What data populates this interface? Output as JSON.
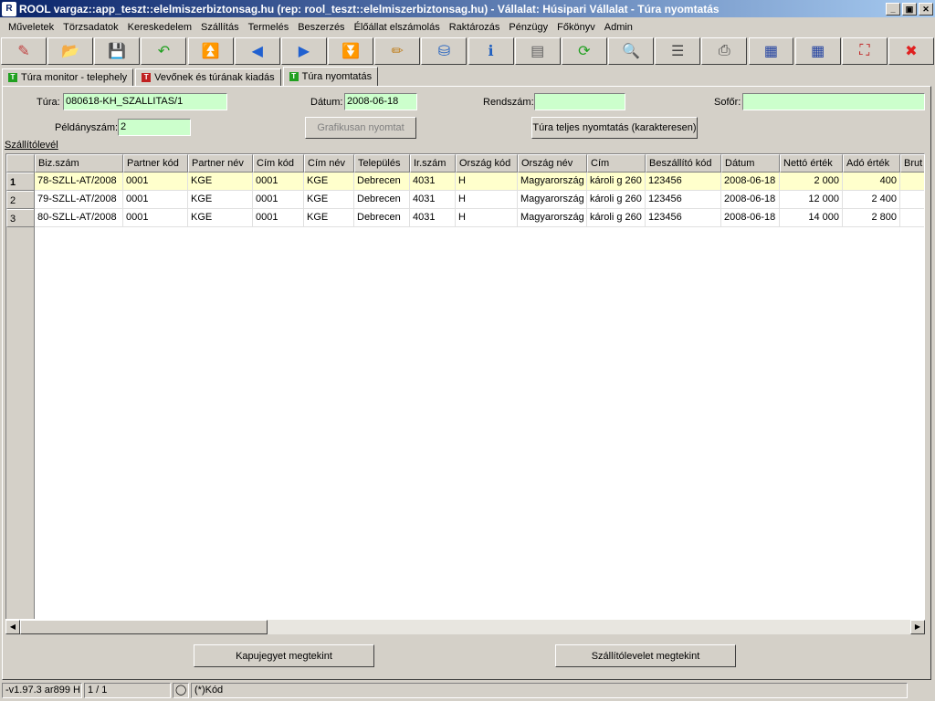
{
  "window": {
    "title": "ROOL vargaz::app_teszt::elelmiszerbiztonsag.hu (rep: rool_teszt::elelmiszerbiztonsag.hu) - Vállalat: Húsipari Vállalat - Túra nyomtatás",
    "minimize": "_",
    "maximize": "▣",
    "close": "✕"
  },
  "menu": [
    "Műveletek",
    "Törzsadatok",
    "Kereskedelem",
    "Szállítás",
    "Termelés",
    "Beszerzés",
    "Élőállat elszámolás",
    "Raktározás",
    "Pénzügy",
    "Főkönyv",
    "Admin"
  ],
  "toolbar": [
    {
      "icon": "edit-bolt-icon",
      "glyph": "✎",
      "color": "#c04040"
    },
    {
      "icon": "open-folder-icon",
      "glyph": "📂",
      "color": "#2060c0"
    },
    {
      "icon": "save-icon",
      "glyph": "💾",
      "color": "#2040a0"
    },
    {
      "icon": "undo-icon",
      "glyph": "↶",
      "color": "#20a020"
    },
    {
      "icon": "first-record-icon",
      "glyph": "⏫",
      "color": "#2060d0"
    },
    {
      "icon": "previous-record-icon",
      "glyph": "◀",
      "color": "#2060d0"
    },
    {
      "icon": "next-record-icon",
      "glyph": "▶",
      "color": "#2060d0"
    },
    {
      "icon": "last-record-icon",
      "glyph": "⏬",
      "color": "#2060d0"
    },
    {
      "icon": "notepad-icon",
      "glyph": "✏",
      "color": "#c08020"
    },
    {
      "icon": "database-icon",
      "glyph": "⛁",
      "color": "#2060c0"
    },
    {
      "icon": "info-icon",
      "glyph": "ℹ",
      "color": "#2060c0"
    },
    {
      "icon": "form-view-icon",
      "glyph": "▤",
      "color": "#606060"
    },
    {
      "icon": "refresh-icon",
      "glyph": "⟳",
      "color": "#20a020"
    },
    {
      "icon": "search-icon",
      "glyph": "🔍",
      "color": "#404040"
    },
    {
      "icon": "columns-icon",
      "glyph": "☰",
      "color": "#404040"
    },
    {
      "icon": "print-icon",
      "glyph": "⎙",
      "color": "#404040"
    },
    {
      "icon": "grid-export-icon",
      "glyph": "▦",
      "color": "#2040a0"
    },
    {
      "icon": "grid-import-icon",
      "glyph": "▦",
      "color": "#2040a0"
    },
    {
      "icon": "fullscreen-icon",
      "glyph": "⛶",
      "color": "#c02020"
    },
    {
      "icon": "exit-icon",
      "glyph": "✖",
      "color": "#e02020"
    }
  ],
  "tabs": [
    {
      "label": "Túra monitor - telephely",
      "icon_color": "#20a020",
      "icon_letter": "T"
    },
    {
      "label": "Vevőnek és túrának kiadás",
      "icon_color": "#c02020",
      "icon_letter": "T"
    },
    {
      "label": "Túra nyomtatás",
      "icon_color": "#20a020",
      "icon_letter": "T"
    }
  ],
  "form": {
    "tura_label": "Túra:",
    "tura_value": "080618-KH_SZALLITAS/1",
    "datum_label": "Dátum:",
    "datum_value": "2008-06-18",
    "rendszam_label": "Rendszám:",
    "rendszam_value": "",
    "sofor_label": "Sofőr:",
    "sofor_value": "",
    "peldanyszam_label": "Példányszám:",
    "peldanyszam_value": "2",
    "grafikus_button": "Grafikusan nyomtat",
    "teljes_button": "Túra teljes nyomtatás (karakteresen)",
    "grid_caption": "Szállítólevél"
  },
  "grid": {
    "columns": [
      "Biz.szám",
      "Partner kód",
      "Partner név",
      "Cím kód",
      "Cím név",
      "Település",
      "Ir.szám",
      "Ország kód",
      "Ország név",
      "Cím",
      "Beszállító kód",
      "Dátum",
      "Nettó érték",
      "Adó érték",
      "Brut"
    ],
    "rows": [
      {
        "num": "1",
        "cells": [
          "78-SZLL-AT/2008",
          "0001",
          "KGE",
          "0001",
          "KGE",
          "Debrecen",
          "4031",
          "H",
          "Magyarország",
          "károli g 260",
          "123456",
          "2008-06-18",
          "2 000",
          "400",
          ""
        ]
      },
      {
        "num": "2",
        "cells": [
          "79-SZLL-AT/2008",
          "0001",
          "KGE",
          "0001",
          "KGE",
          "Debrecen",
          "4031",
          "H",
          "Magyarország",
          "károli g 260",
          "123456",
          "2008-06-18",
          "12 000",
          "2 400",
          ""
        ]
      },
      {
        "num": "3",
        "cells": [
          "80-SZLL-AT/2008",
          "0001",
          "KGE",
          "0001",
          "KGE",
          "Debrecen",
          "4031",
          "H",
          "Magyarország",
          "károli g 260",
          "123456",
          "2008-06-18",
          "14 000",
          "2 800",
          ""
        ]
      }
    ]
  },
  "bottom_buttons": {
    "kapujegy": "Kapujegyet megtekint",
    "szallitolevel": "Szállítólevelet megtekint"
  },
  "status": {
    "version": "-v1.97.3 ar899 H",
    "page": "1 / 1",
    "filter": "(*)Kód"
  }
}
